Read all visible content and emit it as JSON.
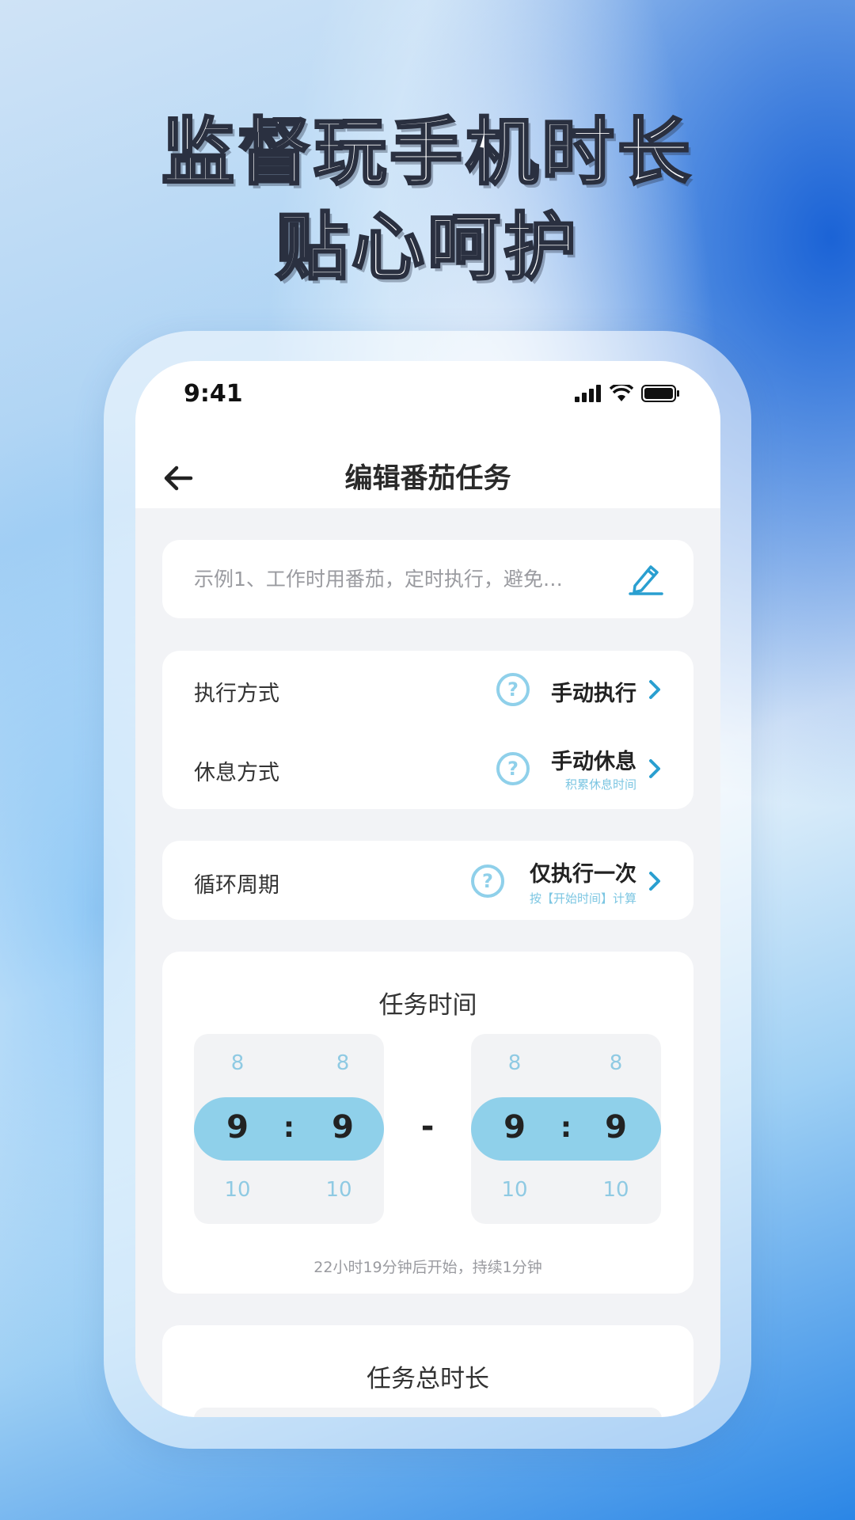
{
  "headline": {
    "line1": "监督玩手机时长",
    "line2": "贴心呵护"
  },
  "status_bar": {
    "time": "9:41",
    "icons": [
      "signal-icon",
      "wifi-icon",
      "battery-icon"
    ]
  },
  "nav": {
    "title": "编辑番茄任务",
    "back_icon": "arrow-left-icon"
  },
  "task_name": {
    "placeholder": "示例1、工作时用番茄，定时执行，避免…",
    "edit_icon": "pencil-icon"
  },
  "settings": [
    {
      "label": "执行方式",
      "value": "手动执行",
      "sub": ""
    },
    {
      "label": "休息方式",
      "value": "手动休息",
      "sub": "积累休息时间"
    }
  ],
  "cycle": {
    "label": "循环周期",
    "value": "仅执行一次",
    "sub": "按【开始时间】计算"
  },
  "task_time": {
    "title": "任务时间",
    "start": {
      "hour_prev": "8",
      "hour": "9",
      "hour_next": "10",
      "min_prev": "8",
      "min": "9",
      "min_next": "10"
    },
    "end": {
      "hour_prev": "8",
      "hour": "9",
      "hour_next": "10",
      "min_prev": "8",
      "min": "9",
      "min_next": "10"
    },
    "colon": ":",
    "separator": "-",
    "note": "22小时19分钟后开始，持续1分钟"
  },
  "total": {
    "title": "任务总时长"
  },
  "colors": {
    "accent": "#8fd0ea",
    "chevron": "#2a9fd0",
    "background": "#f2f3f6"
  }
}
